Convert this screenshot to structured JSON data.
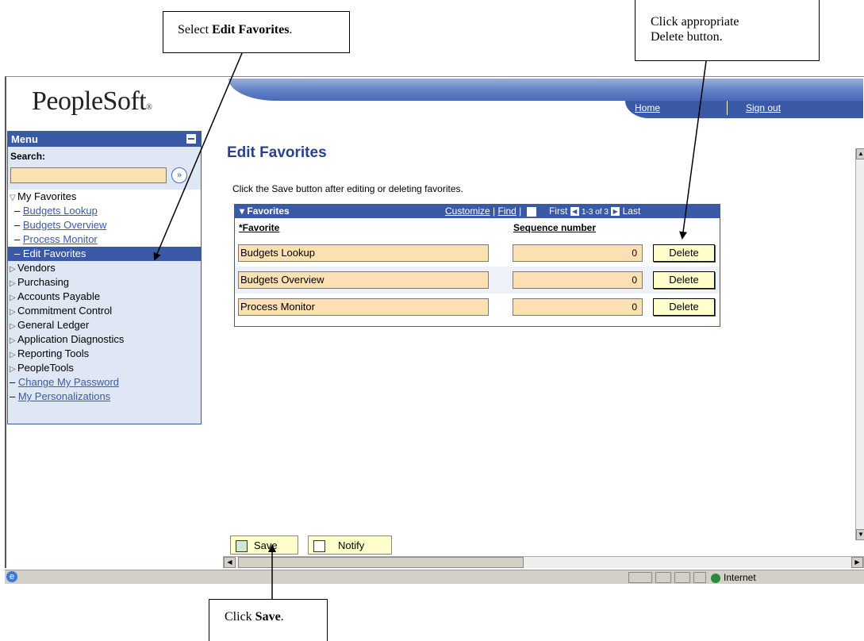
{
  "callouts": {
    "select_prefix": "Select ",
    "select_bold": "Edit Favorites",
    "select_suffix": ".",
    "delete_line1": "Click appropriate",
    "delete_line2": "Delete button.",
    "save_prefix": "Click ",
    "save_bold": "Save",
    "save_suffix": "."
  },
  "header": {
    "logo": "PeopleSoft",
    "logo_mark": "®",
    "home_link": "Home",
    "signout_link": "Sign out"
  },
  "menu": {
    "title": "Menu",
    "search_label": "Search:",
    "search_value": "",
    "search_go_glyph": "»",
    "items": [
      {
        "label": "My Favorites",
        "kind": "folder-open"
      },
      {
        "label": "Budgets Lookup",
        "kind": "link"
      },
      {
        "label": "Budgets Overview",
        "kind": "link"
      },
      {
        "label": "Process Monitor",
        "kind": "link"
      },
      {
        "label": "Edit Favorites",
        "kind": "selected"
      },
      {
        "label": "Vendors",
        "kind": "folder"
      },
      {
        "label": "Purchasing",
        "kind": "folder"
      },
      {
        "label": "Accounts Payable",
        "kind": "folder"
      },
      {
        "label": "Commitment Control",
        "kind": "folder"
      },
      {
        "label": "General Ledger",
        "kind": "folder"
      },
      {
        "label": "Application Diagnostics",
        "kind": "folder"
      },
      {
        "label": "Reporting Tools",
        "kind": "folder"
      },
      {
        "label": "PeopleTools",
        "kind": "folder"
      },
      {
        "label": "Change My Password",
        "kind": "toplink"
      },
      {
        "label": "My Personalizations",
        "kind": "toplink"
      }
    ]
  },
  "main": {
    "title": "Edit Favorites",
    "instruction": "Click the Save button after editing or deleting favorites.",
    "grid": {
      "title": "Favorites",
      "customize": "Customize",
      "find": "Find",
      "first": "First",
      "range": "1-3 of 3",
      "last": "Last",
      "col_favorite": "*Favorite",
      "col_sequence": "Sequence number",
      "rows": [
        {
          "favorite": "Budgets Lookup",
          "sequence": "0",
          "delete": "Delete"
        },
        {
          "favorite": "Budgets Overview",
          "sequence": "0",
          "delete": "Delete"
        },
        {
          "favorite": "Process Monitor",
          "sequence": "0",
          "delete": "Delete"
        }
      ]
    },
    "toolbar": {
      "save": "Save",
      "notify": "Notify"
    }
  },
  "statusbar": {
    "zone": "Internet"
  },
  "colors": {
    "accent": "#3a5aa6",
    "input_bg": "#fbe1b1",
    "button_bg": "#ffffcc"
  }
}
